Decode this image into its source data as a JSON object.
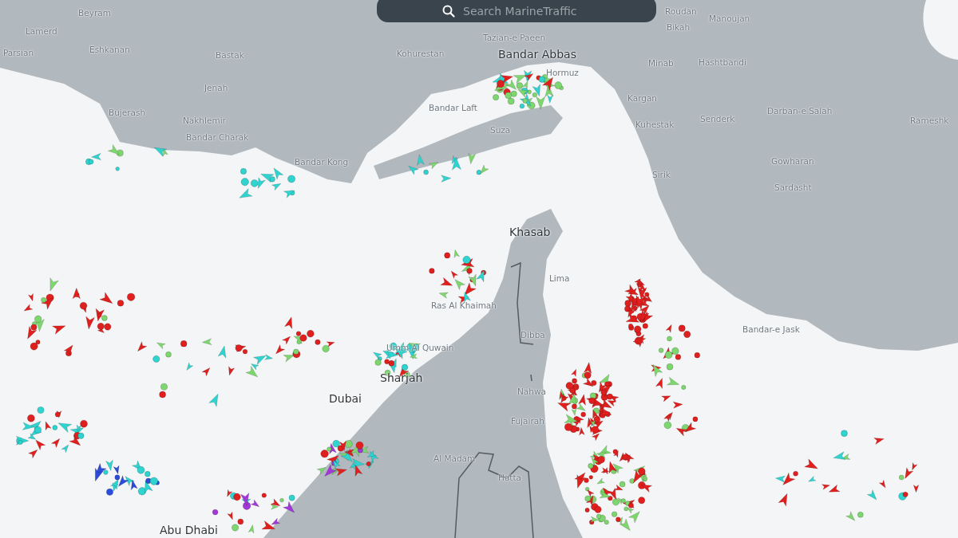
{
  "search": {
    "placeholder": "Search MarineTraffic"
  },
  "map": {
    "labels": [
      {
        "text": "Beyram",
        "kind": "town"
      },
      {
        "text": "Lamerd",
        "kind": "town"
      },
      {
        "text": "Parsian",
        "kind": "town"
      },
      {
        "text": "Eshkanan",
        "kind": "town"
      },
      {
        "text": "Bastak",
        "kind": "town"
      },
      {
        "text": "Jenah",
        "kind": "town"
      },
      {
        "text": "Bujerash",
        "kind": "town"
      },
      {
        "text": "Nakhlemir",
        "kind": "town"
      },
      {
        "text": "Bandar Charak",
        "kind": "town"
      },
      {
        "text": "Bandar Kong",
        "kind": "town"
      },
      {
        "text": "Kohurestan",
        "kind": "town"
      },
      {
        "text": "Bandar Laft",
        "kind": "town"
      },
      {
        "text": "Tazian-e Paeen",
        "kind": "town"
      },
      {
        "text": "Bandar Abbas",
        "kind": "city"
      },
      {
        "text": "Hormuz",
        "kind": "town"
      },
      {
        "text": "Suza",
        "kind": "town"
      },
      {
        "text": "Roudan",
        "kind": "town"
      },
      {
        "text": "Bikah",
        "kind": "town"
      },
      {
        "text": "Manoujan",
        "kind": "town"
      },
      {
        "text": "Minab",
        "kind": "town"
      },
      {
        "text": "Hashtbandi",
        "kind": "town"
      },
      {
        "text": "Kargan",
        "kind": "town"
      },
      {
        "text": "Kuhestak",
        "kind": "town"
      },
      {
        "text": "Senderk",
        "kind": "town"
      },
      {
        "text": "Darban-e Salah",
        "kind": "town"
      },
      {
        "text": "Rameshk",
        "kind": "town"
      },
      {
        "text": "Gowharan",
        "kind": "town"
      },
      {
        "text": "Sardasht",
        "kind": "town"
      },
      {
        "text": "Sirik",
        "kind": "town"
      },
      {
        "text": "Khasab",
        "kind": "city"
      },
      {
        "text": "Lima",
        "kind": "town"
      },
      {
        "text": "Ras Al Khaimah",
        "kind": "town"
      },
      {
        "text": "Dibba",
        "kind": "town"
      },
      {
        "text": "Umm Al Quwain",
        "kind": "town"
      },
      {
        "text": "Sharjah",
        "kind": "city"
      },
      {
        "text": "Dubai",
        "kind": "city"
      },
      {
        "text": "Nahwa",
        "kind": "town"
      },
      {
        "text": "Fujairah",
        "kind": "town"
      },
      {
        "text": "Al Madam",
        "kind": "town"
      },
      {
        "text": "Hatta",
        "kind": "town"
      },
      {
        "text": "Bandar-e Jask",
        "kind": "town"
      },
      {
        "text": "Abu Dhabi",
        "kind": "city"
      }
    ]
  }
}
